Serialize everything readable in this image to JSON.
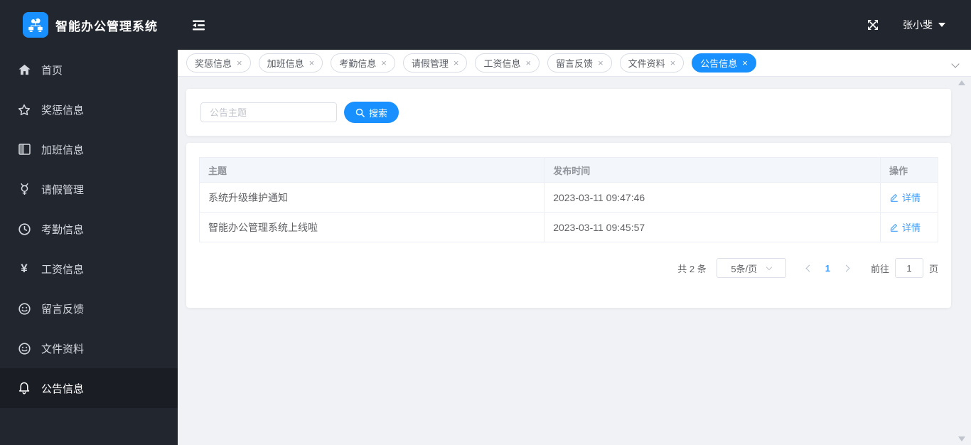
{
  "app": {
    "title": "智能办公管理系统",
    "user_name": "张小斐"
  },
  "icons": {
    "logo": "org-network-icon",
    "collapse": "menu-fold-icon",
    "fullscreen": "fullscreen-expand-icon",
    "user_caret": "caret-down-icon",
    "tab_close_glyph": "×",
    "search": "magnifier-icon",
    "edit": "edit-pen-icon"
  },
  "sidebar": {
    "items": [
      {
        "label": "首页",
        "icon": "home-icon",
        "active": false
      },
      {
        "label": "奖惩信息",
        "icon": "star-icon",
        "active": false
      },
      {
        "label": "加班信息",
        "icon": "notebook-icon",
        "active": false
      },
      {
        "label": "请假管理",
        "icon": "mercury-icon",
        "active": false
      },
      {
        "label": "考勤信息",
        "icon": "clock-icon",
        "active": false
      },
      {
        "label": "工资信息",
        "icon": "yen-icon",
        "active": false
      },
      {
        "label": "留言反馈",
        "icon": "smiley-icon",
        "active": false
      },
      {
        "label": "文件资料",
        "icon": "smiley-icon",
        "active": false
      },
      {
        "label": "公告信息",
        "icon": "bell-icon",
        "active": true
      }
    ]
  },
  "tabs": {
    "items": [
      {
        "label": "奖惩信息",
        "active": false
      },
      {
        "label": "加班信息",
        "active": false
      },
      {
        "label": "考勤信息",
        "active": false
      },
      {
        "label": "请假管理",
        "active": false
      },
      {
        "label": "工资信息",
        "active": false
      },
      {
        "label": "留言反馈",
        "active": false
      },
      {
        "label": "文件资料",
        "active": false
      },
      {
        "label": "公告信息",
        "active": true
      }
    ]
  },
  "search": {
    "placeholder": "公告主题",
    "button_label": "搜索"
  },
  "table": {
    "columns": [
      "主题",
      "发布时间",
      "操作"
    ],
    "rows": [
      {
        "subject": "系统升级维护通知",
        "time": "2023-03-11 09:47:46",
        "action": "详情"
      },
      {
        "subject": "智能办公管理系统上线啦",
        "time": "2023-03-11 09:45:57",
        "action": "详情"
      }
    ]
  },
  "pagination": {
    "total_label": "共 2 条",
    "page_size_label": "5条/页",
    "current_page": "1",
    "goto_label": "前往",
    "goto_value": "1",
    "page_unit": "页"
  },
  "colors": {
    "accent": "#1890ff",
    "link": "#409eff",
    "header_bg": "#22262e",
    "sidebar_active_bg": "#1a1d24",
    "content_bg": "#f0f2f5",
    "table_header_bg": "#f3f6fb",
    "table_border": "#ebeef5"
  }
}
